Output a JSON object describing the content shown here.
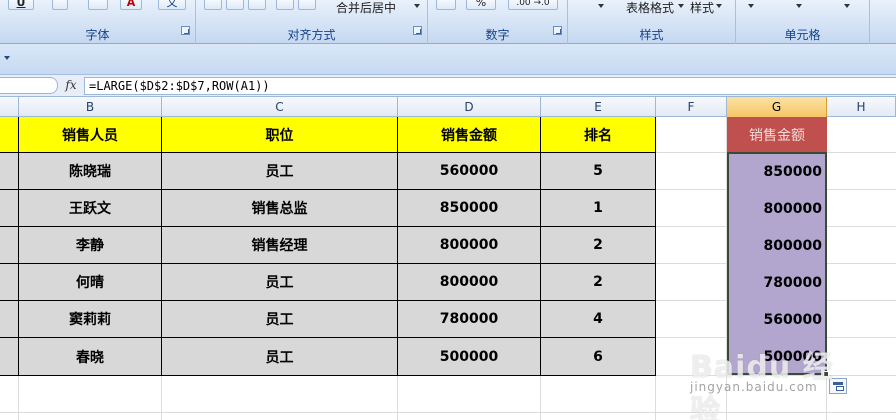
{
  "ribbon": {
    "groups": {
      "font": "字体",
      "alignment": "对齐方式",
      "number": "数字",
      "styles": "样式",
      "cells": "单元格"
    },
    "merge_center_label": "合并后居中",
    "table_format_label": "表格格式",
    "cell_style_label": "样式",
    "percent_symbol": "%",
    "decimal_label": ".00 →.0",
    "wen_label": "文"
  },
  "formula_bar": {
    "fx_label": "fx",
    "formula": "=LARGE($D$2:$D$7,ROW(A1))"
  },
  "columns": [
    "B",
    "C",
    "D",
    "E",
    "F",
    "G",
    "H"
  ],
  "selected_column": "G",
  "table": {
    "headers": [
      "销售人员",
      "职位",
      "销售金额",
      "排名"
    ],
    "rows": [
      [
        "陈晓瑞",
        "员工",
        "560000",
        "5"
      ],
      [
        "王跃文",
        "销售总监",
        "850000",
        "1"
      ],
      [
        "李静",
        "销售经理",
        "800000",
        "2"
      ],
      [
        "何晴",
        "员工",
        "800000",
        "2"
      ],
      [
        "窦莉莉",
        "员工",
        "780000",
        "4"
      ],
      [
        "春晓",
        "员工",
        "500000",
        "6"
      ]
    ]
  },
  "sorted": {
    "header": "销售金额",
    "values": [
      "850000",
      "800000",
      "800000",
      "780000",
      "560000",
      "500000"
    ]
  },
  "watermark": {
    "brand": "Baidu 经验",
    "url": "jingyan.baidu.com"
  },
  "colors": {
    "header_fill": "#ffff00",
    "data_fill": "#d8d8d8",
    "sorted_header_fill": "#c0504d",
    "sorted_fill": "#b2a6cf",
    "selected_column_header": "#f6c567"
  }
}
